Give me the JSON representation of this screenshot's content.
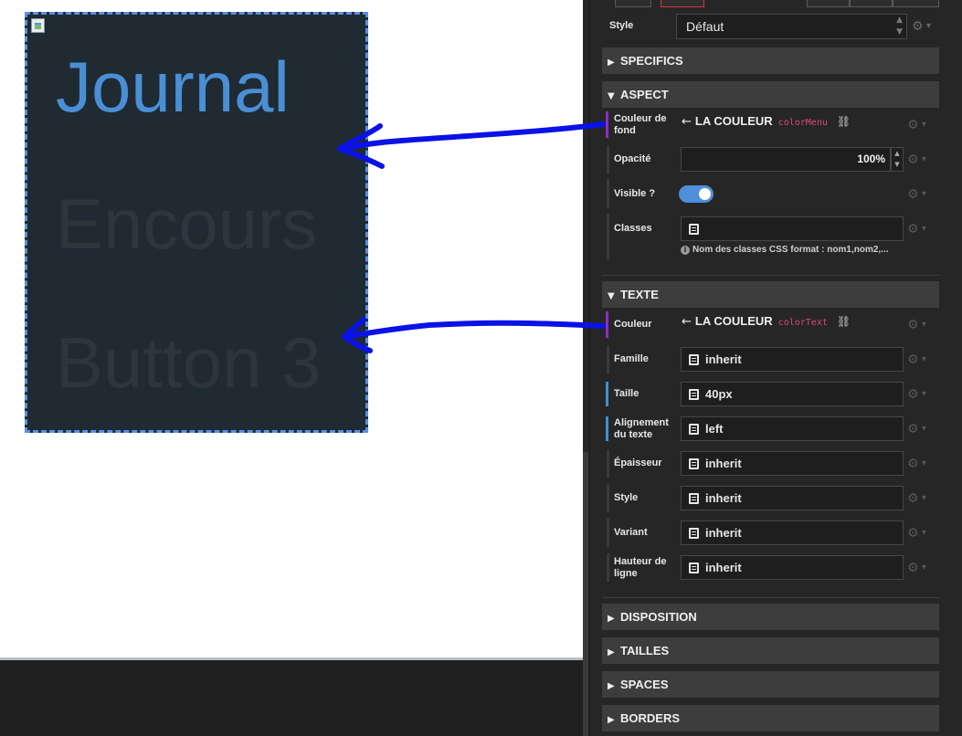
{
  "canvas": {
    "menu_items": [
      "Journal",
      "Encours",
      "Button 3"
    ]
  },
  "panel": {
    "style_label": "Style",
    "style_value": "Défaut",
    "sections": {
      "specifics": "SPECIFICS",
      "aspect": "ASPECT",
      "texte": "TEXTE",
      "disposition": "DISPOSITION",
      "tailles": "TAILLES",
      "spaces": "SPACES",
      "borders": "BORDERS"
    },
    "aspect": {
      "bg_label": "Couleur de fond",
      "bg_prefix": "LA",
      "bg_name": "COULEUR",
      "bg_var": "colorMenu",
      "opacity_label": "Opacité",
      "opacity_value": "100%",
      "visible_label": "Visible ?",
      "visible_on": true,
      "classes_label": "Classes",
      "classes_value": "",
      "classes_hint": "Nom des classes CSS format : nom1,nom2,..."
    },
    "texte": {
      "color_label": "Couleur",
      "color_prefix": "LA",
      "color_name": "COULEUR",
      "color_var": "colorText",
      "famille_label": "Famille",
      "famille_value": "inherit",
      "taille_label": "Taille",
      "taille_value": "40px",
      "align_label": "Alignement du texte",
      "align_value": "left",
      "epaisseur_label": "Épaisseur",
      "epaisseur_value": "inherit",
      "style_label": "Style",
      "style_value": "inherit",
      "variant_label": "Variant",
      "variant_value": "inherit",
      "hauteur_label": "Hauteur de ligne",
      "hauteur_value": "inherit"
    }
  },
  "colors": {
    "menu_background": "#1f2a33",
    "menu_active_text": "#4a8fd4",
    "menu_inactive_text": "#2e353b",
    "panel_background": "#262626",
    "accent_purple": "#8a2fc0",
    "accent_blue": "#3b8fd6",
    "annotation_arrow": "#0a12e6",
    "css_var_pink": "#d8487e"
  },
  "icons": {
    "gear": "gear-icon",
    "chevron": "chevron-down-icon",
    "doc": "document-icon",
    "unlink": "unlink-icon",
    "info": "info-icon"
  }
}
